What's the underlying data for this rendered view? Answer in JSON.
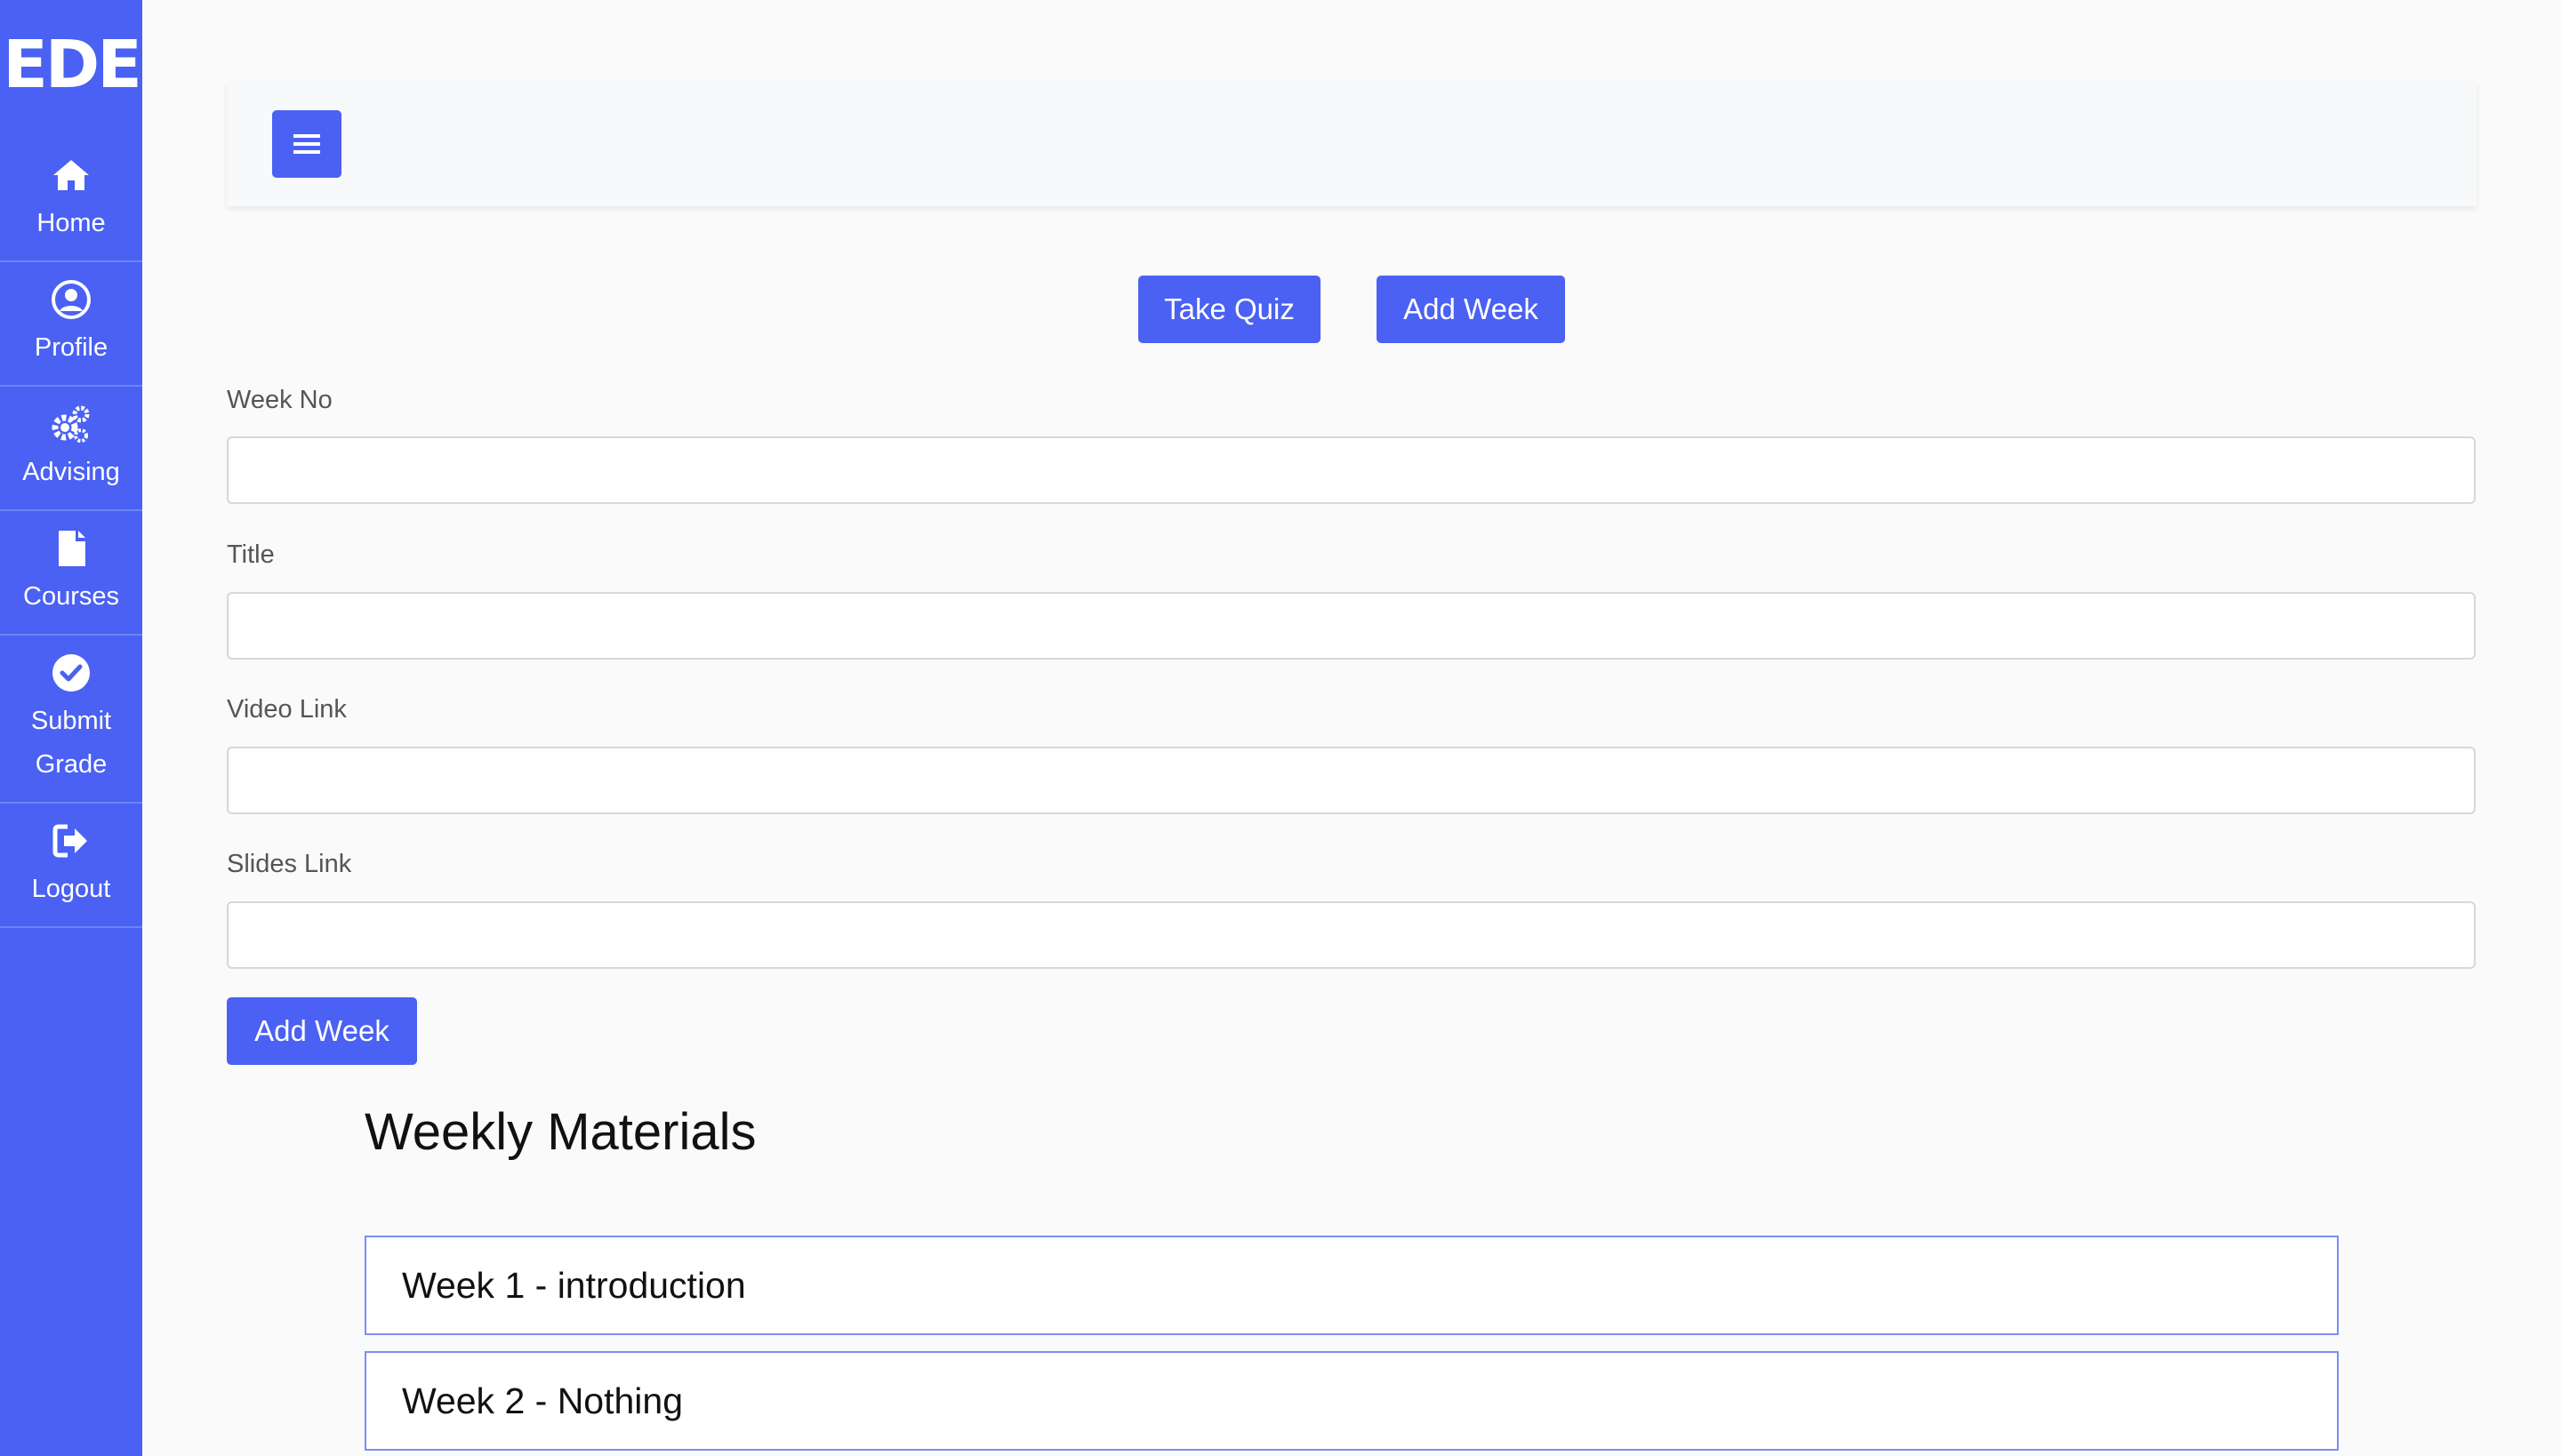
{
  "sidebar": {
    "logo": "EDE",
    "items": [
      {
        "label": "Home",
        "icon": "home-icon"
      },
      {
        "label": "Profile",
        "icon": "user-circle-icon"
      },
      {
        "label": "Advising",
        "icon": "gears-icon"
      },
      {
        "label": "Courses",
        "icon": "file-icon"
      },
      {
        "label": "Submit\nGrade",
        "icon": "check-circle-icon"
      },
      {
        "label": "Logout",
        "icon": "sign-out-icon"
      }
    ]
  },
  "topbar": {
    "toggle_icon": "menu-icon"
  },
  "actions": {
    "take_quiz": "Take Quiz",
    "add_week": "Add Week"
  },
  "form": {
    "week_no_label": "Week No",
    "week_no_value": "",
    "title_label": "Title",
    "title_value": "",
    "video_link_label": "Video Link",
    "video_link_value": "",
    "slides_link_label": "Slides Link",
    "slides_link_value": "",
    "submit_label": "Add Week"
  },
  "materials": {
    "title": "Weekly Materials",
    "weeks": [
      {
        "label": "Week 1 - introduction"
      },
      {
        "label": "Week 2 - Nothing"
      }
    ]
  },
  "colors": {
    "primary": "#4a61f3",
    "background": "#fafafa",
    "topbar": "#f8f9fa",
    "card_border": "#7a8ef6"
  }
}
